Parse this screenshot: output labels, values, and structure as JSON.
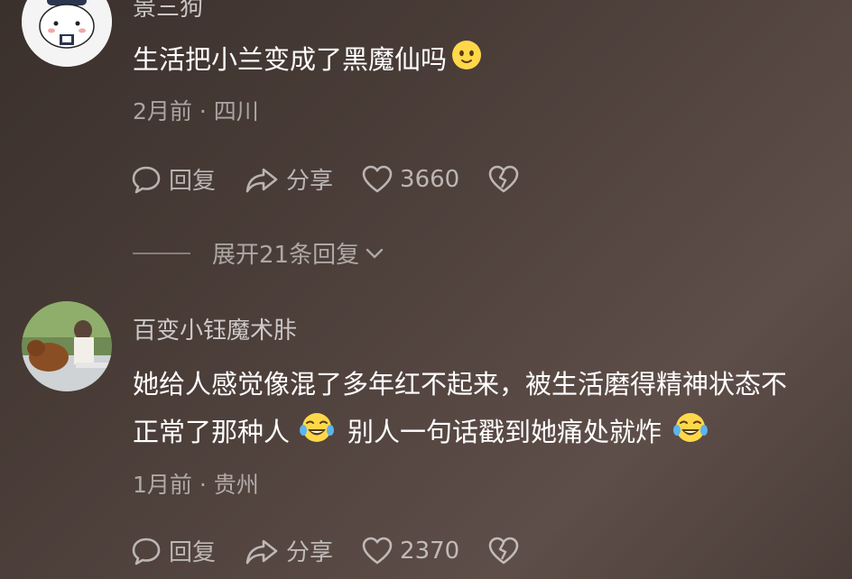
{
  "comments": [
    {
      "username": "景三狗",
      "text_lines": [
        "生活把小兰变成了黑魔仙吗"
      ],
      "meta": "2月前 · 四川",
      "reply_label": "回复",
      "share_label": "分享",
      "like_count": "3660",
      "avatar_icon": "cartoon-cat-avatar"
    },
    {
      "username": "百变小钰魔术胩",
      "text_line1": "她给人感觉像混了多年红不起来，被生活磨得精神状态不",
      "text_line2_part1": "正常了那种人",
      "text_line2_part2": "别人一句话戳到她痛处就炸",
      "meta": "1月前 · 贵州",
      "reply_label": "回复",
      "share_label": "分享",
      "like_count": "2370",
      "avatar_icon": "photo-avatar-dog"
    }
  ],
  "expand_replies": "展开21条回复",
  "colors": {
    "background": "#4e403b",
    "text_primary": "#ffffff",
    "text_secondary": "#b8aeaa"
  }
}
